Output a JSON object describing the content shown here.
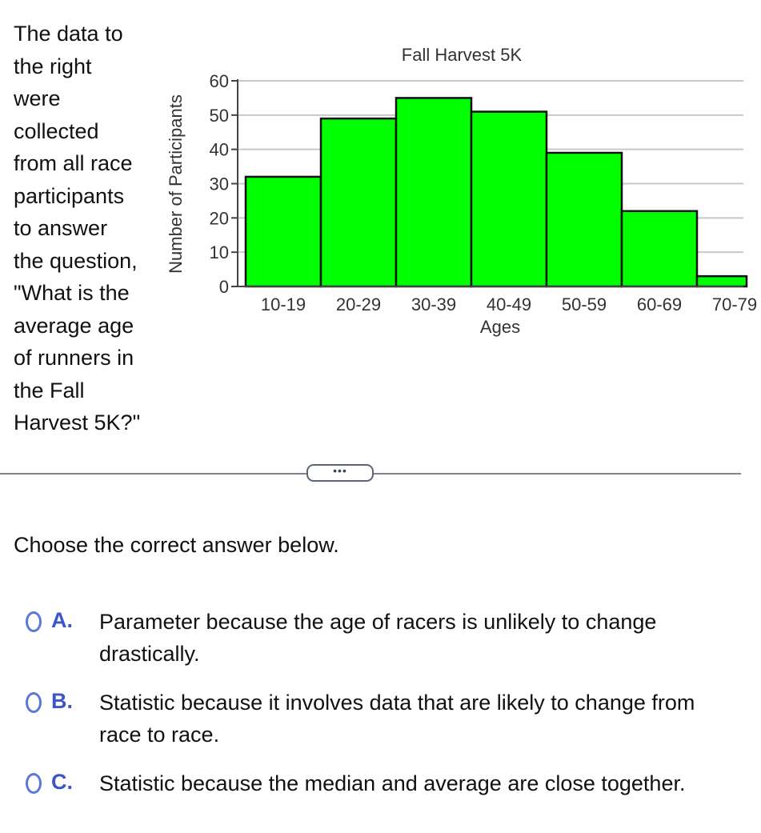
{
  "question": {
    "lines": [
      "The data to",
      "the right",
      "were",
      "collected",
      "from all race",
      "participants",
      "to answer",
      "the question,",
      "\"What is the",
      "average age",
      "of runners in",
      "the Fall",
      "Harvest 5K?\""
    ]
  },
  "expand_button": {
    "label": "•••"
  },
  "prompt": "Choose the correct answer below.",
  "options": [
    {
      "letter": "A.",
      "text": "Parameter because the age of racers is unlikely to change drastically."
    },
    {
      "letter": "B.",
      "text": "Statistic because it involves data that are likely to change from race to race."
    },
    {
      "letter": "C.",
      "text": "Statistic because the median and average are close together."
    }
  ],
  "colors": {
    "bar_fill": "#00ff00",
    "bar_stroke": "#111111",
    "grid": "#c8c8c8",
    "option_letter": "#3a56c8"
  },
  "chart_data": {
    "type": "bar",
    "title": "Fall Harvest 5K",
    "xlabel": "Ages",
    "ylabel": "Number of Participants",
    "categories": [
      "10-19",
      "20-29",
      "30-39",
      "40-49",
      "50-59",
      "60-69",
      "70-79"
    ],
    "values": [
      32,
      49,
      55,
      51,
      39,
      22,
      3
    ],
    "ylim": [
      0,
      60
    ],
    "yticks": [
      0,
      10,
      20,
      30,
      40,
      50,
      60
    ],
    "grid": true,
    "legend": "none"
  }
}
